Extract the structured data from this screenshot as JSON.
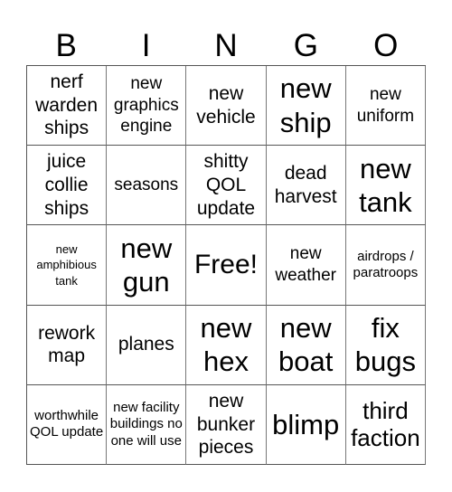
{
  "header": [
    "B",
    "I",
    "N",
    "G",
    "O"
  ],
  "cells": [
    {
      "text": "nerf warden ships",
      "size": "s-md"
    },
    {
      "text": "new graphics engine",
      "size": "s-sm"
    },
    {
      "text": "new vehicle",
      "size": "s-md"
    },
    {
      "text": "new ship",
      "size": "s-xl"
    },
    {
      "text": "new uniform",
      "size": "s-sm"
    },
    {
      "text": "juice collie ships",
      "size": "s-md"
    },
    {
      "text": "seasons",
      "size": "s-sm"
    },
    {
      "text": "shitty QOL update",
      "size": "s-md"
    },
    {
      "text": "dead harvest",
      "size": "s-md"
    },
    {
      "text": "new tank",
      "size": "s-xl"
    },
    {
      "text": "new amphibious tank",
      "size": "s-xxs"
    },
    {
      "text": "new gun",
      "size": "s-xl"
    },
    {
      "text": "Free!",
      "size": "s-free"
    },
    {
      "text": "new weather",
      "size": "s-sm"
    },
    {
      "text": "airdrops / paratroops",
      "size": "s-xs"
    },
    {
      "text": "rework map",
      "size": "s-md"
    },
    {
      "text": "planes",
      "size": "s-md"
    },
    {
      "text": "new hex",
      "size": "s-xl"
    },
    {
      "text": "new boat",
      "size": "s-xl"
    },
    {
      "text": "fix bugs",
      "size": "s-xl"
    },
    {
      "text": "worthwhile QOL update",
      "size": "s-xs"
    },
    {
      "text": "new facility buildings no one will use",
      "size": "s-xs"
    },
    {
      "text": "new bunker pieces",
      "size": "s-md"
    },
    {
      "text": "blimp",
      "size": "s-xl"
    },
    {
      "text": "third faction",
      "size": "s-lg"
    }
  ]
}
